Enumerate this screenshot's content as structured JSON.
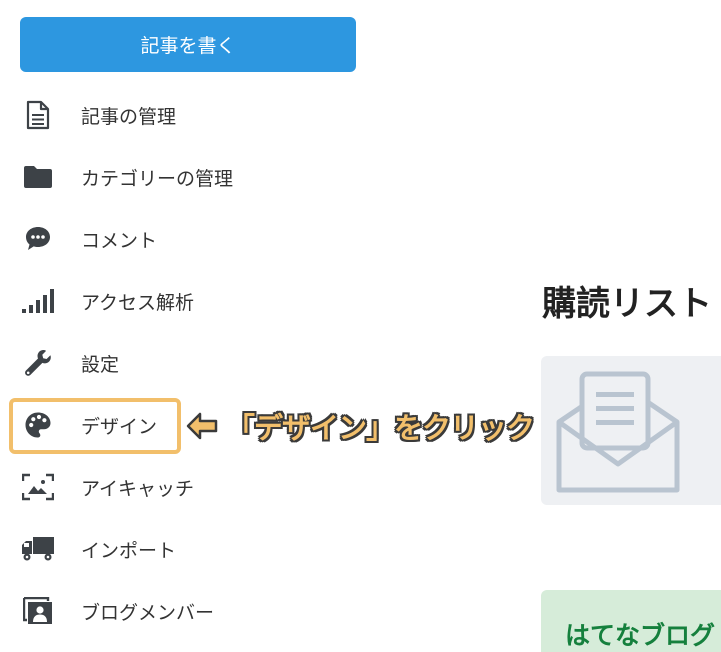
{
  "write_button": {
    "label": "記事を書く"
  },
  "sidebar": {
    "items": [
      {
        "label": "記事の管理",
        "icon": "document-icon"
      },
      {
        "label": "カテゴリーの管理",
        "icon": "folder-icon"
      },
      {
        "label": "コメント",
        "icon": "comment-icon"
      },
      {
        "label": "アクセス解析",
        "icon": "signal-bars-icon"
      },
      {
        "label": "設定",
        "icon": "wrench-icon"
      },
      {
        "label": "デザイン",
        "icon": "palette-icon"
      },
      {
        "label": "アイキャッチ",
        "icon": "image-frame-icon"
      },
      {
        "label": "インポート",
        "icon": "truck-icon"
      },
      {
        "label": "ブログメンバー",
        "icon": "member-card-icon"
      }
    ]
  },
  "annotation": {
    "text": "「デザイン」をクリック"
  },
  "main": {
    "section_title": "購読リスト",
    "banner_text": "はてなブログ"
  },
  "colors": {
    "primary": "#2d97e0",
    "icon": "#3d4247",
    "highlight": "#f2bf6b",
    "card_bg": "#eef0f3",
    "mail_icon": "#b9c4d0",
    "banner_bg": "#d6ecd9",
    "banner_text": "#15803d"
  }
}
